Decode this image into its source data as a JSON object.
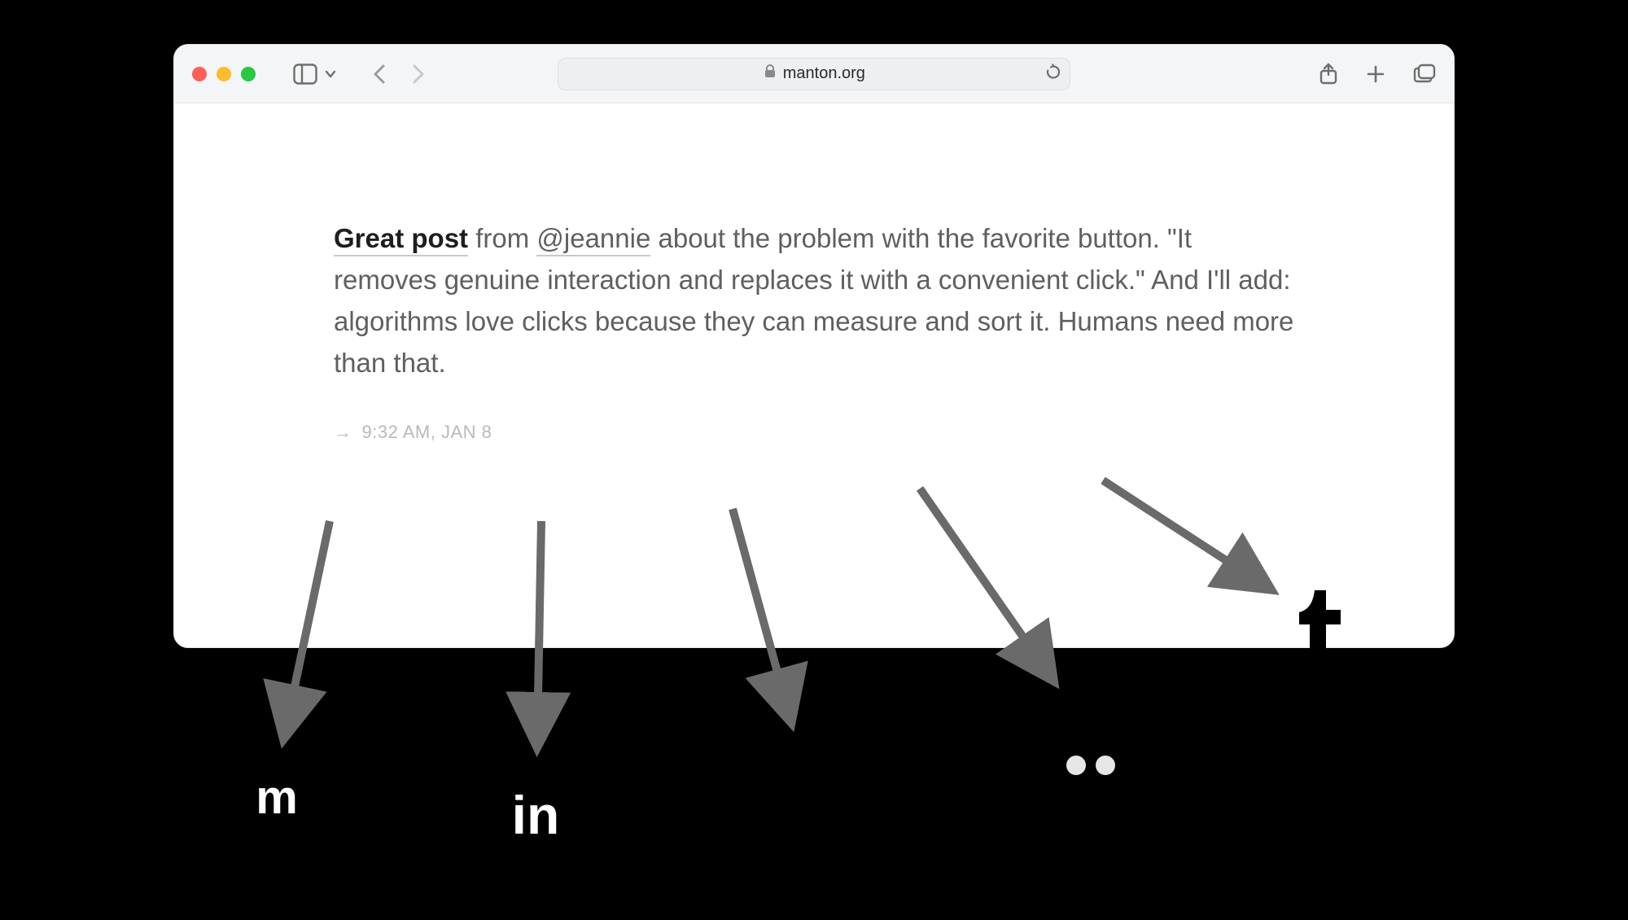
{
  "browser": {
    "url_display": "manton.org"
  },
  "post": {
    "lead_link": "Great post",
    "segment_before_mention": " from ",
    "mention": "@jeannie",
    "segment_after_mention": " about the problem with the favorite button. \"It removes genuine interaction and replaces it with a convenient click.\" And I'll add: algorithms love clicks because they can measure and sort it. Humans need more than that."
  },
  "meta": {
    "arrow": "→",
    "timestamp": "9:32 AM, JAN 8"
  },
  "badges": {
    "mastodon_glyph": "m",
    "linkedin_glyph": "in"
  }
}
